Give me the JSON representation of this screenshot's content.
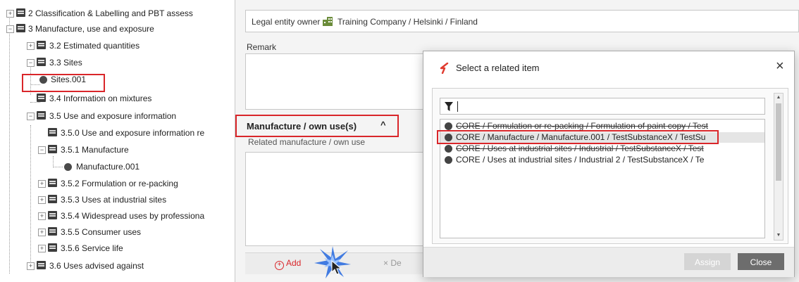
{
  "tree": {
    "items": [
      {
        "expander": "+",
        "icon": "book-icon",
        "label": "2 Classification & Labelling and PBT assess"
      },
      {
        "expander": "−",
        "icon": "book-icon",
        "label": "3 Manufacture, use and exposure"
      },
      {
        "expander": "+",
        "icon": "book-icon",
        "label": "3.2 Estimated quantities"
      },
      {
        "expander": "−",
        "icon": "book-icon",
        "label": "3.3 Sites"
      },
      {
        "expander": "",
        "icon": "record-icon",
        "label": "Sites.001"
      },
      {
        "expander": "",
        "icon": "book-icon",
        "label": "3.4 Information on mixtures"
      },
      {
        "expander": "−",
        "icon": "book-icon",
        "label": "3.5 Use and exposure information"
      },
      {
        "expander": "",
        "icon": "book-icon",
        "label": "3.5.0 Use and exposure information re"
      },
      {
        "expander": "−",
        "icon": "book-icon",
        "label": "3.5.1 Manufacture"
      },
      {
        "expander": "",
        "icon": "record-icon",
        "label": "Manufacture.001"
      },
      {
        "expander": "+",
        "icon": "book-icon",
        "label": "3.5.2 Formulation or re-packing"
      },
      {
        "expander": "+",
        "icon": "book-icon",
        "label": "3.5.3 Uses at industrial sites"
      },
      {
        "expander": "+",
        "icon": "book-icon",
        "label": "3.5.4 Widespread uses by professiona"
      },
      {
        "expander": "+",
        "icon": "book-icon",
        "label": "3.5.5 Consumer uses"
      },
      {
        "expander": "+",
        "icon": "book-icon",
        "label": "3.5.6 Service life"
      },
      {
        "expander": "+",
        "icon": "book-icon",
        "label": "3.6 Uses advised against"
      }
    ]
  },
  "form": {
    "owner_label": "Legal entity owner",
    "owner_value": "Training Company / Helsinki / Finland",
    "remark_label": "Remark",
    "section_title": "Manufacture / own use(s)",
    "section_chevron": "^",
    "related_label": "Related manufacture / own use",
    "add_label": "Add",
    "add_icon": "+",
    "delete_label": "× De"
  },
  "dialog": {
    "title": "Select a related item",
    "close_glyph": "×",
    "filter_value": "",
    "items": [
      {
        "label": "CORE / Formulation or re-packing / Formulation of paint copy / Test",
        "selected": false,
        "struck": true
      },
      {
        "label": "CORE / Manufacture / Manufacture.001 / TestSubstanceX / TestSu",
        "selected": true,
        "struck": false
      },
      {
        "label": "CORE / Uses at industrial sites / Industrial / TestSubstanceX / Test",
        "selected": false,
        "struck": true
      },
      {
        "label": "CORE / Uses at industrial sites / Industrial 2 / TestSubstanceX / Te",
        "selected": false,
        "struck": false
      }
    ],
    "scroll_up": "▲",
    "scroll_down": "▼",
    "assign_label": "Assign",
    "close_label": "Close"
  },
  "colors": {
    "highlight_red": "#d9262a",
    "accent_red": "#e03b2f",
    "close_button": "#6d6d6d"
  }
}
